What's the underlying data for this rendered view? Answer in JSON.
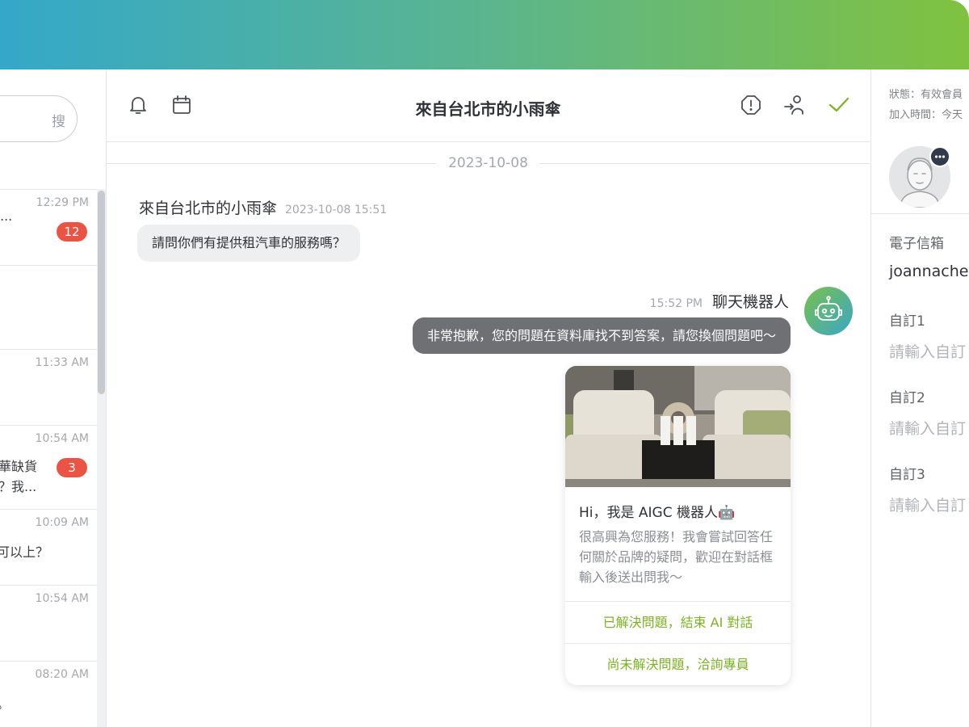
{
  "conversations": {
    "search_placeholder": "搜",
    "items": [
      {
        "time": "12:29 PM",
        "line1": "...",
        "line2": "",
        "badge": "12"
      },
      {
        "time": "",
        "line1": "",
        "line2": "",
        "badge": ""
      },
      {
        "time": "11:33 AM",
        "line1": "",
        "line2": "",
        "badge": ""
      },
      {
        "time": "10:54 AM",
        "line1": "華缺貨",
        "line2": "？我...",
        "badge": "3"
      },
      {
        "time": "10:09 AM",
        "line1": "可以上？",
        "line2": "",
        "badge": ""
      },
      {
        "time": "10:54 AM",
        "line1": "",
        "line2": "",
        "badge": ""
      },
      {
        "time": "08:20 AM",
        "line1": "。",
        "line2": "",
        "badge": ""
      }
    ]
  },
  "chat": {
    "title": "來自台北市的小雨傘",
    "date_separator": "2023-10-08",
    "incoming": {
      "sender": "來自台北市的小雨傘",
      "timestamp": "2023-10-08 15:51",
      "text": "請問你們有提供租汽車的服務嗎？"
    },
    "bot": {
      "name": "聊天機器人",
      "timestamp": "15:52 PM",
      "text": "非常抱歉，您的問題在資料庫找不到答案，請您換個問題吧～"
    },
    "card": {
      "title": "Hi，我是 AIGC 機器人🤖",
      "body": "很高興為您服務！我會嘗試回答任何關於品牌的疑問，歡迎在對話框輸入後送出問我～",
      "button1": "已解決問題，結束 AI 對話",
      "button2": "尚未解決問題，洽詢專員"
    }
  },
  "profile": {
    "status": "狀態：有效會員",
    "join_time": "加入時間：今天",
    "email_label": "電子信箱",
    "email_value": "joannachen",
    "custom1_label": "自訂1",
    "custom1_placeholder": "請輸入自訂",
    "custom2_label": "自訂2",
    "custom2_placeholder": "請輸入自訂",
    "custom3_label": "自訂3",
    "custom3_placeholder": "請輸入自訂"
  },
  "colors": {
    "accent_green": "#7bb31f",
    "badge_red": "#ea5444",
    "bot_bubble": "#6f7073"
  }
}
